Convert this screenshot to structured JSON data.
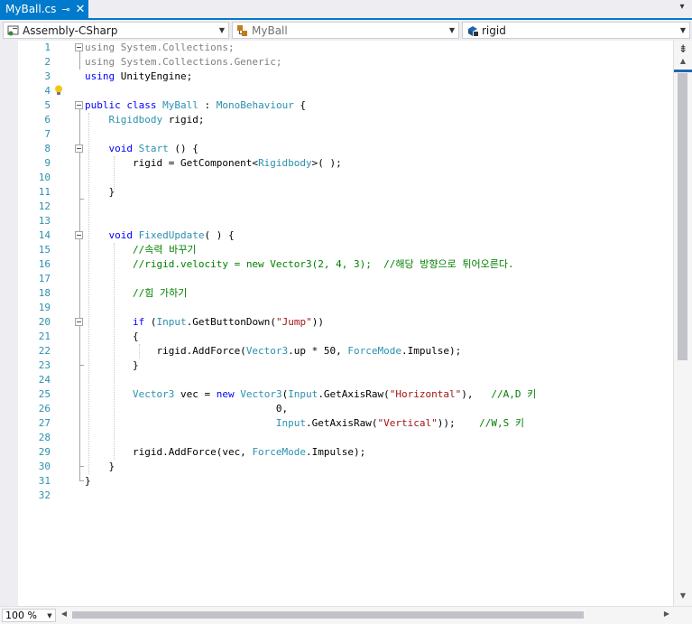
{
  "tab": {
    "title": "MyBall.cs",
    "pin_glyph": "⊸",
    "close_glyph": "✕"
  },
  "navbar": {
    "project": "Assembly-CSharp",
    "type": "MyBall",
    "member": "rigid"
  },
  "zoom": "100 %",
  "lines": [
    {
      "n": "1",
      "fold": true,
      "parts": [
        [
          "gray",
          "using System.Collections;"
        ]
      ]
    },
    {
      "n": "2",
      "parts": [
        [
          "gray",
          "using System.Collections.Generic;"
        ]
      ]
    },
    {
      "n": "3",
      "parts": [
        [
          "kw",
          "using"
        ],
        [
          "",
          " UnityEngine;"
        ]
      ]
    },
    {
      "n": "4",
      "parts": []
    },
    {
      "n": "5",
      "fold": true,
      "parts": [
        [
          "kw",
          "public class "
        ],
        [
          "ty",
          "MyBall"
        ],
        [
          "",
          " : "
        ],
        [
          "ty",
          "MonoBehaviour"
        ],
        [
          "",
          " {"
        ]
      ]
    },
    {
      "n": "6",
      "parts": [
        [
          "",
          "    "
        ],
        [
          "ty",
          "Rigidbody"
        ],
        [
          "",
          " rigid;"
        ]
      ]
    },
    {
      "n": "7",
      "parts": []
    },
    {
      "n": "8",
      "fold": true,
      "parts": [
        [
          "",
          "    "
        ],
        [
          "kw",
          "void "
        ],
        [
          "ty",
          "Start"
        ],
        [
          "",
          " () {"
        ]
      ]
    },
    {
      "n": "9",
      "parts": [
        [
          "",
          "        rigid = GetComponent<"
        ],
        [
          "ty",
          "Rigidbody"
        ],
        [
          "",
          ">( );"
        ]
      ]
    },
    {
      "n": "10",
      "parts": []
    },
    {
      "n": "11",
      "parts": [
        [
          "",
          "    }"
        ]
      ]
    },
    {
      "n": "12",
      "parts": []
    },
    {
      "n": "13",
      "parts": []
    },
    {
      "n": "14",
      "fold": true,
      "parts": [
        [
          "",
          "    "
        ],
        [
          "kw",
          "void "
        ],
        [
          "ty",
          "FixedUpdate"
        ],
        [
          "",
          "( ) {"
        ]
      ]
    },
    {
      "n": "15",
      "parts": [
        [
          "",
          "        "
        ],
        [
          "cm",
          "//속력 바꾸기"
        ]
      ]
    },
    {
      "n": "16",
      "parts": [
        [
          "",
          "        "
        ],
        [
          "cm",
          "//rigid.velocity = new Vector3(2, 4, 3);  //해당 방향으로 튀어오른다."
        ]
      ]
    },
    {
      "n": "17",
      "parts": []
    },
    {
      "n": "18",
      "parts": [
        [
          "",
          "        "
        ],
        [
          "cm",
          "//힘 가하기"
        ]
      ]
    },
    {
      "n": "19",
      "parts": []
    },
    {
      "n": "20",
      "fold": true,
      "parts": [
        [
          "",
          "        "
        ],
        [
          "kw",
          "if"
        ],
        [
          "",
          " ("
        ],
        [
          "ty",
          "Input"
        ],
        [
          "",
          ".GetButtonDown("
        ],
        [
          "st",
          "\"Jump\""
        ],
        [
          "",
          "))"
        ]
      ]
    },
    {
      "n": "21",
      "parts": [
        [
          "",
          "        {"
        ]
      ]
    },
    {
      "n": "22",
      "parts": [
        [
          "",
          "            rigid.AddForce("
        ],
        [
          "ty",
          "Vector3"
        ],
        [
          "",
          ".up * 50, "
        ],
        [
          "ty",
          "ForceMode"
        ],
        [
          "",
          ".Impulse);"
        ]
      ]
    },
    {
      "n": "23",
      "parts": [
        [
          "",
          "        }"
        ]
      ]
    },
    {
      "n": "24",
      "parts": []
    },
    {
      "n": "25",
      "parts": [
        [
          "",
          "        "
        ],
        [
          "ty",
          "Vector3"
        ],
        [
          "",
          " vec = "
        ],
        [
          "kw",
          "new "
        ],
        [
          "ty",
          "Vector3"
        ],
        [
          "",
          "("
        ],
        [
          "ty",
          "Input"
        ],
        [
          "",
          ".GetAxisRaw("
        ],
        [
          "st",
          "\"Horizontal\""
        ],
        [
          "",
          "),   "
        ],
        [
          "cm",
          "//A,D 키"
        ]
      ]
    },
    {
      "n": "26",
      "parts": [
        [
          "",
          "                                0,"
        ]
      ]
    },
    {
      "n": "27",
      "parts": [
        [
          "",
          "                                "
        ],
        [
          "ty",
          "Input"
        ],
        [
          "",
          ".GetAxisRaw("
        ],
        [
          "st",
          "\"Vertical\""
        ],
        [
          "",
          "));    "
        ],
        [
          "cm",
          "//W,S 키"
        ]
      ]
    },
    {
      "n": "28",
      "parts": []
    },
    {
      "n": "29",
      "parts": [
        [
          "",
          "        rigid.AddForce(vec, "
        ],
        [
          "ty",
          "ForceMode"
        ],
        [
          "",
          ".Impulse);"
        ]
      ]
    },
    {
      "n": "30",
      "parts": [
        [
          "",
          "    }"
        ]
      ]
    },
    {
      "n": "31",
      "parts": [
        [
          "",
          "}"
        ]
      ]
    },
    {
      "n": "32",
      "parts": []
    }
  ]
}
